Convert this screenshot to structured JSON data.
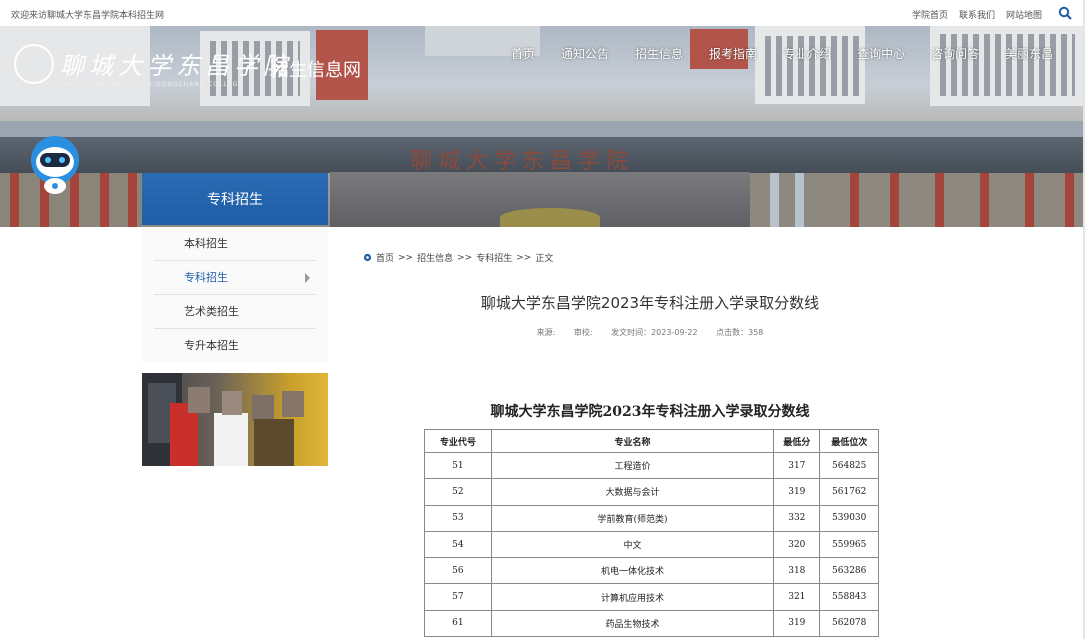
{
  "topbar": {
    "welcome": "欢迎来访聊城大学东昌学院本科招生网",
    "links": [
      "学院首页",
      "联系我们",
      "网站地图"
    ],
    "search_icon": "search-icon"
  },
  "header": {
    "logo_cn": "聊城大学东昌学院",
    "logo_en": "LIAOCHENG UNIVERSITY DONGCHANG COLLEGE",
    "site_name": "招生信息网",
    "gate_text": "聊城大学东昌学院",
    "nav": [
      "首页",
      "通知公告",
      "招生信息",
      "报考指南",
      "专业介绍",
      "查询中心",
      "咨询问答",
      "美丽东昌"
    ]
  },
  "sidebar": {
    "title": "专科招生",
    "items": [
      {
        "label": "本科招生"
      },
      {
        "label": "专科招生"
      },
      {
        "label": "艺术类招生"
      },
      {
        "label": "专升本招生"
      }
    ]
  },
  "breadcrumb": [
    "首页",
    ">>",
    "招生信息",
    ">>",
    "专科招生",
    ">>",
    "正文"
  ],
  "article": {
    "title": "聊城大学东昌学院2023年专科注册入学录取分数线",
    "meta": {
      "source": "来源:",
      "reviewer": "审校:",
      "date": "发文时间：2023-09-22",
      "clicks": "点击数：358"
    },
    "table_title": "聊城大学东昌学院2023年专科注册入学录取分数线",
    "table": {
      "headers": [
        "专业代号",
        "专业名称",
        "最低分",
        "最低位次"
      ],
      "rows": [
        [
          "51",
          "工程造价",
          "317",
          "564825"
        ],
        [
          "52",
          "大数据与会计",
          "319",
          "561762"
        ],
        [
          "53",
          "学前教育(师范类)",
          "332",
          "539030"
        ],
        [
          "54",
          "中文",
          "320",
          "559965"
        ],
        [
          "56",
          "机电一体化技术",
          "318",
          "563286"
        ],
        [
          "57",
          "计算机应用技术",
          "321",
          "558843"
        ],
        [
          "61",
          "药品生物技术",
          "319",
          "562078"
        ]
      ]
    }
  },
  "colors": {
    "brand_blue": "#1f5ea7",
    "gate_red": "#a4443a"
  }
}
